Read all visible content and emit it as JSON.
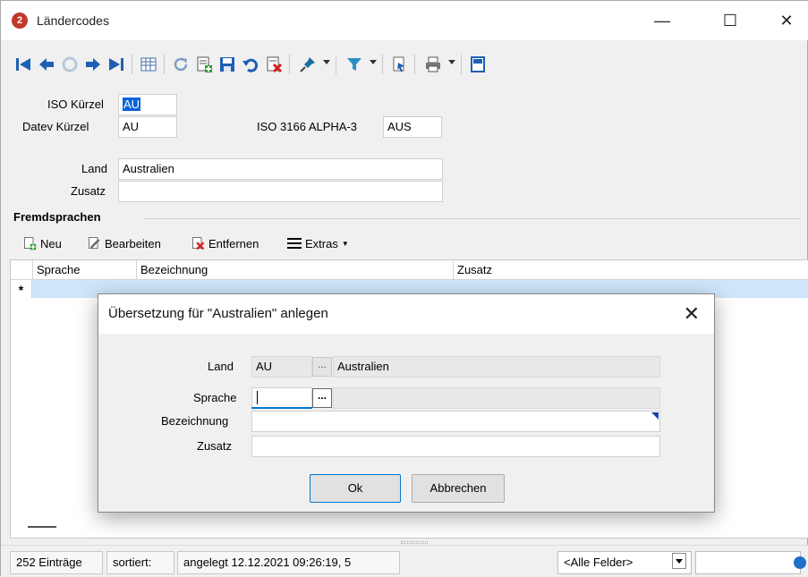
{
  "window": {
    "title": "Ländercodes",
    "app_icon": "2",
    "minimize": "—",
    "maximize": "☐",
    "close": "✕"
  },
  "toolbar": {
    "icons": [
      "first-record-icon",
      "previous-record-icon",
      "refresh-disabled-icon",
      "next-record-icon",
      "last-record-icon",
      "table-view-icon",
      "reload-icon",
      "new-record-icon",
      "save-icon",
      "undo-icon",
      "delete-icon",
      "pin-icon",
      "filter-icon",
      "document-icon",
      "print-icon",
      "layout-icon"
    ]
  },
  "form": {
    "iso_kuerzel_label": "ISO Kürzel",
    "iso_kuerzel_value": "AU",
    "datev_kuerzel_label": "Datev Kürzel",
    "datev_kuerzel_value": "AU",
    "iso3166_label": "ISO 3166 ALPHA-3",
    "iso3166_value": "AUS",
    "land_label": "Land",
    "land_value": "Australien",
    "zusatz_label": "Zusatz",
    "zusatz_value": ""
  },
  "fremdsprachen": {
    "section_title": "Fremdsprachen",
    "toolbar": {
      "new_label": "Neu",
      "edit_label": "Bearbeiten",
      "remove_label": "Entfernen",
      "extras_label": "Extras"
    },
    "columns": [
      "Sprache",
      "Bezeichnung",
      "Zusatz"
    ],
    "new_row_marker": "*"
  },
  "status": {
    "entries": "252 Einträge",
    "sorted": "sortiert:",
    "created": "angelegt 12.12.2021 09:26:19, 5",
    "filter_field": "<Alle Felder>"
  },
  "dialog": {
    "title": "Übersetzung für \"Australien\" anlegen",
    "close": "✕",
    "land_label": "Land",
    "land_code": "AU",
    "land_name": "Australien",
    "dots_disabled": "...",
    "sprache_label": "Sprache",
    "sprache_value": "",
    "dots_active": "...",
    "sprache_name": "",
    "bezeichnung_label": "Bezeichnung",
    "bezeichnung_value": "",
    "zusatz_label": "Zusatz",
    "zusatz_value": "",
    "ok_label": "Ok",
    "cancel_label": "Abbrechen"
  }
}
